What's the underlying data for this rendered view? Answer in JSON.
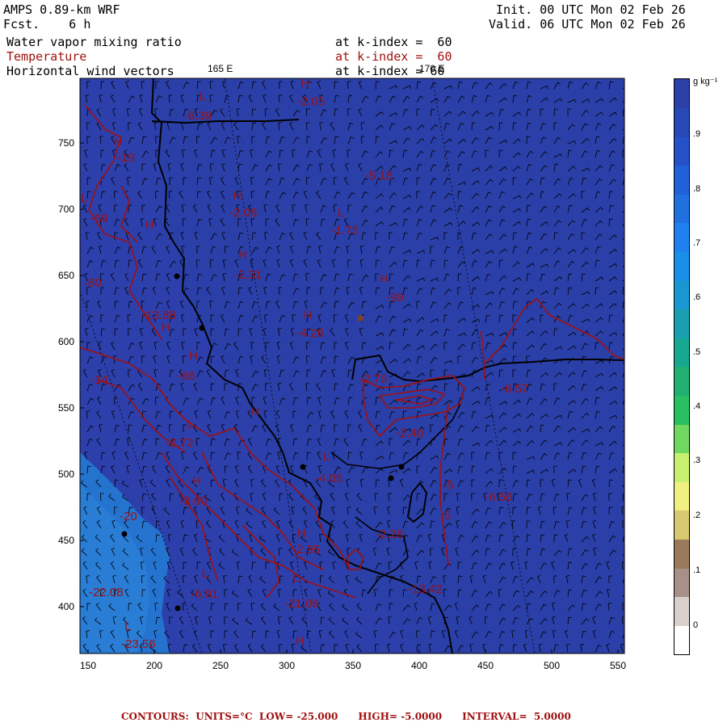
{
  "header": {
    "model": "AMPS 0.89-km WRF",
    "forecast": "Fcst.    6 h",
    "init": "Init. 00 UTC Mon 02 Feb 26",
    "valid": "Valid. 06 UTC Mon 02 Feb 26",
    "fields": [
      {
        "name": "Water vapor mixing ratio",
        "level": "at k-index =  60",
        "color": "#000000"
      },
      {
        "name": "Temperature",
        "level": "at k-index =  60",
        "color": "#a01010"
      },
      {
        "name": "Horizontal wind vectors",
        "level": "at k-index = 60",
        "color": "#000000"
      }
    ]
  },
  "map": {
    "background_color": "#2a3fa8",
    "moist_region_color": "#1e8fe0",
    "coast_color": "#000000",
    "contour_color": "#a01010",
    "meridian_labels": [
      "165 E",
      "170 E"
    ],
    "x_ticks": [
      "150",
      "200",
      "250",
      "300",
      "350",
      "400",
      "450",
      "500",
      "550"
    ],
    "y_ticks": [
      "750",
      "700",
      "650",
      "600",
      "550",
      "500",
      "450",
      "400"
    ],
    "temperature_labels": [
      "-8.39",
      "-2.05",
      "-19",
      "-5.18",
      "-2.08",
      "-59",
      "-1.75",
      "-2.31",
      "-80",
      "-13.88",
      "-99",
      "-4.26",
      "-14",
      "-66",
      "-6.57",
      "-2.76",
      "-2.72",
      "-2.40",
      "-4.05",
      "-3.60",
      "-6.56",
      "-20",
      "-2.26",
      "-2.95",
      "-22.08",
      "-6.91",
      "-21.06",
      "-13.42",
      "-23.56",
      "-5",
      "-5"
    ],
    "marker_labels": [
      "H",
      "L"
    ]
  },
  "colorbar": {
    "units": "g kg⁻¹",
    "labels": [
      ".9",
      ".8",
      ".7",
      ".6",
      ".5",
      ".4",
      ".3",
      ".2",
      ".1",
      "0"
    ],
    "colors": [
      "#ffffff",
      "#d9d0cc",
      "#a89088",
      "#9a7a5a",
      "#d8c870",
      "#f0f080",
      "#c8f070",
      "#70d860",
      "#28c060",
      "#20b070",
      "#18a890",
      "#18a0b0",
      "#1898d0",
      "#1890e8",
      "#2080f0",
      "#2070e0",
      "#2060d8",
      "#2450c8",
      "#2848b8",
      "#2c40a8"
    ]
  },
  "footer": "CONTOURS:  UNITS=°C  LOW= -25.000      HIGH= -5.0000      INTERVAL=  5.0000"
}
